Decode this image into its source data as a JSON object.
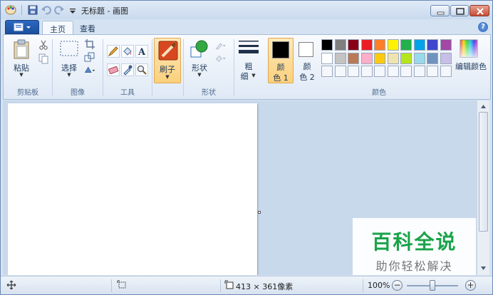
{
  "window": {
    "title": "无标题 - 画图"
  },
  "quick_access": {
    "icons": [
      "save-icon",
      "undo-icon",
      "redo-icon",
      "customize-dropdown-icon"
    ]
  },
  "tabs": [
    {
      "label": "主页",
      "active": true
    },
    {
      "label": "查看",
      "active": false
    }
  ],
  "ribbon": {
    "clipboard": {
      "label": "剪贴板",
      "paste_label": "粘贴"
    },
    "image": {
      "label": "图像",
      "select_label": "选择"
    },
    "tools": {
      "label": "工具"
    },
    "brush": {
      "label": "刷子"
    },
    "shapes": {
      "label": "形状",
      "shapes_label": "形状"
    },
    "size": {
      "label_line1": "粗",
      "label_line2": "细"
    },
    "colors": {
      "label": "颜色",
      "color1_line1": "颜",
      "color1_line2": "色 1",
      "color2_line1": "颜",
      "color2_line2": "色 2",
      "edit_colors_label": "编辑颜色",
      "color1_value": "#000000",
      "color2_value": "#ffffff",
      "palette_row1": [
        "#000000",
        "#7f7f7f",
        "#880015",
        "#ed1c24",
        "#ff7f27",
        "#fff200",
        "#22b14c",
        "#00a2e8",
        "#3f48cc",
        "#a349a4"
      ],
      "palette_row2": [
        "#ffffff",
        "#c3c3c3",
        "#b97a57",
        "#ffaec9",
        "#ffc90e",
        "#efe4b0",
        "#b5e61d",
        "#99d9ea",
        "#7092be",
        "#c8bfe7"
      ]
    }
  },
  "status": {
    "image_size": "413 × 361像素",
    "zoom": "100%"
  },
  "watermark": {
    "title": "百科全说",
    "subtitle": "助你轻松解决"
  }
}
